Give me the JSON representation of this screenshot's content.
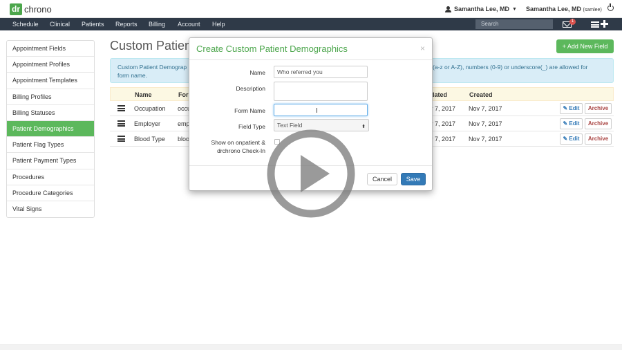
{
  "brand": {
    "logo_dr": "dr",
    "logo_chrono": "chrono"
  },
  "header": {
    "user_menu": "Samantha Lee, MD",
    "user_right": "Samantha Lee, MD",
    "username": "(samlee)"
  },
  "nav": {
    "items": [
      "Schedule",
      "Clinical",
      "Patients",
      "Reports",
      "Billing",
      "Account",
      "Help"
    ],
    "search_placeholder": "Search",
    "mail_badge": "1"
  },
  "sidebar": {
    "items": [
      {
        "label": "Appointment Fields"
      },
      {
        "label": "Appointment Profiles"
      },
      {
        "label": "Appointment Templates"
      },
      {
        "label": "Billing Profiles"
      },
      {
        "label": "Billing Statuses"
      },
      {
        "label": "Patient Demographics",
        "active": true
      },
      {
        "label": "Patient Flag Types"
      },
      {
        "label": "Patient Payment Types"
      },
      {
        "label": "Procedures"
      },
      {
        "label": "Procedure Categories"
      },
      {
        "label": "Vital Signs"
      }
    ]
  },
  "main": {
    "title": "Custom Patient",
    "add_button": "+ Add New Field",
    "info_left": "Custom Patient Demograp form name.",
    "info_right": "(a-z or A-Z), numbers (0-9) or underscore(_) are allowed for"
  },
  "table": {
    "headers": {
      "name": "Name",
      "form": "For",
      "updated": "dated",
      "created": "Created"
    },
    "rows": [
      {
        "name": "Occupation",
        "form": "occu",
        "updated": "v 7, 2017",
        "created": "Nov 7, 2017"
      },
      {
        "name": "Employer",
        "form": "emp",
        "updated": "v 7, 2017",
        "created": "Nov 7, 2017"
      },
      {
        "name": "Blood Type",
        "form": "bloo",
        "updated": "v 7, 2017",
        "created": "Nov 7, 2017"
      }
    ],
    "edit_label": "✎ Edit",
    "archive_label": "Archive"
  },
  "modal": {
    "title": "Create Custom Patient Demographics",
    "close": "×",
    "name_label": "Name",
    "name_value": "Who referred you",
    "description_label": "Description",
    "description_value": "",
    "form_name_label": "Form Name",
    "form_name_value": "",
    "field_type_label": "Field Type",
    "field_type_value": "Text Field",
    "show_label_1": "Show on onpatient &",
    "show_label_2": "drchrono Check-In",
    "cancel": "Cancel",
    "save": "Save"
  },
  "colors": {
    "brand_green": "#5cb85c",
    "navbar": "#2f3a48",
    "primary": "#337ab7",
    "info_bg": "#d9edf7",
    "table_header_bg": "#fcf8e3",
    "danger": "#a94442"
  }
}
